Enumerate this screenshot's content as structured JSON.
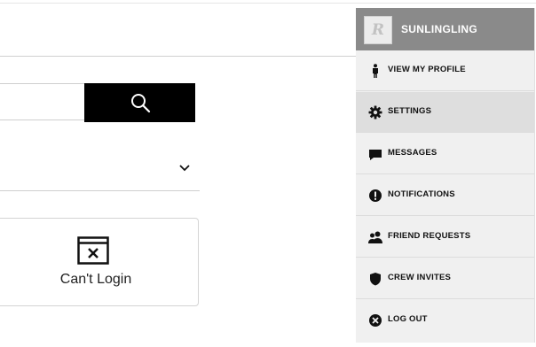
{
  "search": {
    "placeholder": "",
    "button_icon": "search-icon"
  },
  "dropdown": {
    "selected": "",
    "icon": "chevron-down-icon"
  },
  "help_card": {
    "label": "Can't Login",
    "icon": "window-close-icon"
  },
  "user_menu": {
    "username": "SUNLINGLING",
    "avatar_icon": "rockstar-logo-icon",
    "avatar_text": "R",
    "header_color": "#8a8a8a",
    "items": [
      {
        "label": "VIEW MY PROFILE",
        "icon": "person-icon"
      },
      {
        "label": "SETTINGS",
        "icon": "gear-icon",
        "active": true
      },
      {
        "label": "MESSAGES",
        "icon": "message-icon"
      },
      {
        "label": "NOTIFICATIONS",
        "icon": "alert-icon"
      },
      {
        "label": "FRIEND REQUESTS",
        "icon": "friends-icon"
      },
      {
        "label": "CREW INVITES",
        "icon": "shield-icon"
      },
      {
        "label": "LOG OUT",
        "icon": "logout-icon"
      }
    ]
  }
}
